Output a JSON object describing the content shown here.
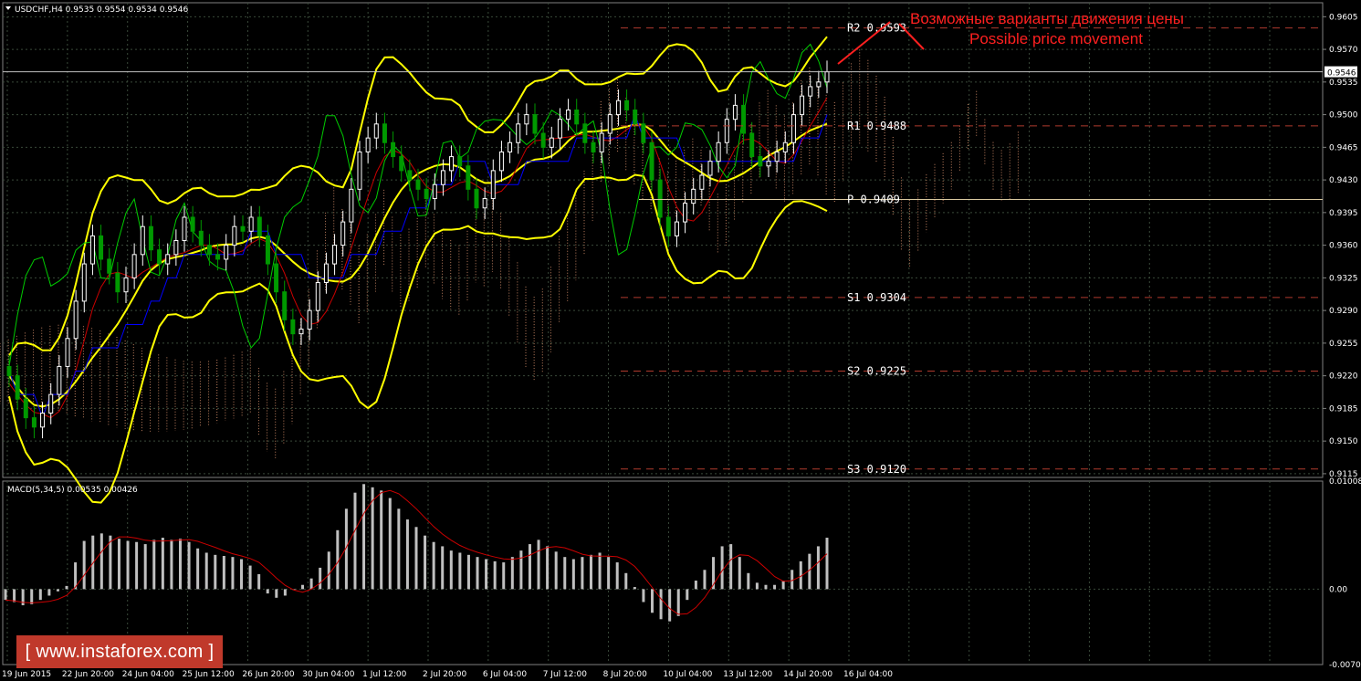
{
  "symbol_header": "USDCHF,H4  0.9535 0.9554 0.9534 0.9546",
  "macd_header": "MACD(5,34,5) 0.00535 0.00426",
  "annotation": {
    "ru": "Возможные варианты движения цены",
    "en": "Possible price movement"
  },
  "watermark": "[ www.instaforex.com ]",
  "colors": {
    "background": "#000000",
    "grid": "#3a4a3a",
    "bull_candle": "#ffffff",
    "bear_candle": "#009900",
    "bollinger": "#ffff00",
    "kijun": "#0000ff",
    "tenkan": "#cc0000",
    "chikou": "#00cc00",
    "cloud": "#c08060",
    "levels": "#b03a2e",
    "annotation": "#ff2020",
    "macd_hist": "#c0c0c0",
    "macd_signal": "#cc0000"
  },
  "chart_data": [
    {
      "type": "candlestick",
      "title": "USDCHF,H4",
      "ylim": [
        0.9111,
        0.962
      ],
      "yticks": [
        "0.9605",
        "0.9570",
        "0.9535",
        "0.9500",
        "0.9465",
        "0.9430",
        "0.9395",
        "0.9360",
        "0.9325",
        "0.9290",
        "0.9255",
        "0.9220",
        "0.9185",
        "0.9150",
        "0.9115"
      ],
      "xticks": [
        "19 Jun 2015",
        "22 Jun 20:00",
        "24 Jun 04:00",
        "25 Jun 12:00",
        "26 Jun 20:00",
        "30 Jun 04:00",
        "1 Jul 12:00",
        "2 Jul 20:00",
        "6 Jul 04:00",
        "7 Jul 12:00",
        "8 Jul 20:00",
        "10 Jul 04:00",
        "13 Jul 12:00",
        "14 Jul 20:00",
        "16 Jul 04:00"
      ],
      "current_price": "0.9546",
      "levels": [
        {
          "name": "R2",
          "label": "R2  0.9593",
          "value": 0.9593
        },
        {
          "name": "R1",
          "label": "R1  0.9488",
          "value": 0.9488
        },
        {
          "name": "P",
          "label": "P  0.9409",
          "value": 0.9409
        },
        {
          "name": "S1",
          "label": "S1  0.9304",
          "value": 0.9304
        },
        {
          "name": "S2",
          "label": "S2  0.9225",
          "value": 0.9225
        },
        {
          "name": "S3",
          "label": "S3  0.9120",
          "value": 0.912
        }
      ],
      "close": [
        0.922,
        0.9195,
        0.9175,
        0.9165,
        0.918,
        0.92,
        0.923,
        0.926,
        0.93,
        0.934,
        0.937,
        0.9345,
        0.933,
        0.931,
        0.9325,
        0.935,
        0.938,
        0.9355,
        0.934,
        0.935,
        0.9365,
        0.939,
        0.9375,
        0.936,
        0.935,
        0.9345,
        0.936,
        0.938,
        0.9375,
        0.939,
        0.937,
        0.934,
        0.931,
        0.928,
        0.9265,
        0.927,
        0.929,
        0.932,
        0.934,
        0.936,
        0.9385,
        0.942,
        0.946,
        0.9475,
        0.949,
        0.947,
        0.9455,
        0.944,
        0.943,
        0.942,
        0.941,
        0.9425,
        0.944,
        0.9455,
        0.9445,
        0.942,
        0.94,
        0.941,
        0.944,
        0.946,
        0.947,
        0.949,
        0.95,
        0.948,
        0.9465,
        0.9475,
        0.9495,
        0.9505,
        0.949,
        0.947,
        0.946,
        0.948,
        0.95,
        0.9515,
        0.9505,
        0.949,
        0.947,
        0.943,
        0.939,
        0.937,
        0.9385,
        0.9405,
        0.942,
        0.9435,
        0.945,
        0.947,
        0.9495,
        0.951,
        0.948,
        0.9455,
        0.9445,
        0.945,
        0.946,
        0.947,
        0.95,
        0.952,
        0.953,
        0.9535,
        0.9546
      ],
      "macd_hist": [
        -0.001,
        -0.0012,
        -0.0015,
        -0.0014,
        -0.001,
        -0.0006,
        -0.0002,
        0.0003,
        0.0025,
        0.0045,
        0.005,
        0.0052,
        0.005,
        0.0047,
        0.0045,
        0.0044,
        0.0042,
        0.0046,
        0.0048,
        0.0046,
        0.0047,
        0.0044,
        0.0038,
        0.0034,
        0.0032,
        0.0031,
        0.003,
        0.0028,
        0.0022,
        0.0014,
        -0.0004,
        -0.0008,
        -0.0006,
        0.0,
        0.0004,
        0.001,
        0.002,
        0.0035,
        0.0055,
        0.0075,
        0.009,
        0.0098,
        0.0095,
        0.0092,
        0.0085,
        0.0075,
        0.0065,
        0.0058,
        0.005,
        0.0044,
        0.004,
        0.0036,
        0.0034,
        0.0032,
        0.003,
        0.0028,
        0.0026,
        0.0025,
        0.003,
        0.0036,
        0.0042,
        0.0046,
        0.004,
        0.0035,
        0.003,
        0.0028,
        0.003,
        0.0032,
        0.0034,
        0.003,
        0.0025,
        0.0015,
        0.0002,
        -0.0012,
        -0.0022,
        -0.0028,
        -0.003,
        -0.0025,
        -0.001,
        0.0008,
        0.0018,
        0.003,
        0.004,
        0.0042,
        0.003,
        0.0015,
        0.0006,
        0.0004,
        0.0004,
        0.0008,
        0.0018,
        0.0026,
        0.0033,
        0.004,
        0.0048
      ],
      "macd_ylim": [
        -0.00703,
        0.01008
      ],
      "macd_yticks": [
        "0.01008",
        "0.00",
        "-0.00703"
      ]
    }
  ]
}
